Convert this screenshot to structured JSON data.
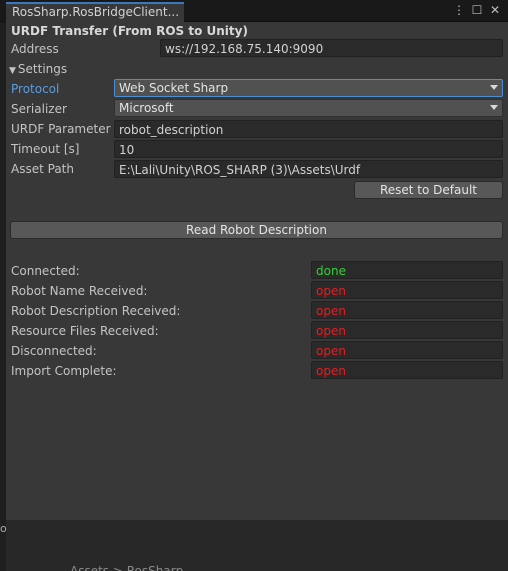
{
  "tab": {
    "title": "RosSharp.RosBridgeClient..."
  },
  "window_icons": {
    "menu": "⋮",
    "maximize": "☐",
    "close": "✕"
  },
  "header": {
    "title": "URDF Transfer (From ROS to Unity)"
  },
  "address": {
    "label": "Address",
    "value": "ws://192.168.75.140:9090"
  },
  "settings": {
    "label": "Settings",
    "toggle_icon": "▼"
  },
  "protocol": {
    "label": "Protocol",
    "value": "Web Socket Sharp"
  },
  "serializer": {
    "label": "Serializer",
    "value": "Microsoft"
  },
  "urdf_parameter": {
    "label": "URDF Parameter",
    "value": "robot_description"
  },
  "timeout": {
    "label": "Timeout [s]",
    "value": "10"
  },
  "asset_path": {
    "label": "Asset Path",
    "value": "E:\\Lali\\Unity\\ROS_SHARP (3)\\Assets\\Urdf"
  },
  "buttons": {
    "reset": "Reset to Default",
    "read": "Read Robot Description"
  },
  "status": [
    {
      "label": "Connected:",
      "value": "done",
      "color": "#35d135"
    },
    {
      "label": "Robot Name Received:",
      "value": "open",
      "color": "#e02020"
    },
    {
      "label": "Robot Description Received:",
      "value": "open",
      "color": "#e02020"
    },
    {
      "label": "Resource Files Received:",
      "value": "open",
      "color": "#e02020"
    },
    {
      "label": "Disconnected:",
      "value": "open",
      "color": "#e02020"
    },
    {
      "label": "Import Complete:",
      "value": "open",
      "color": "#e02020"
    }
  ],
  "colors": {
    "label_active": "#5b9de1",
    "done": "#35d135",
    "open": "#e02020"
  },
  "background": {
    "edge_text": "o",
    "breadcrumb": "Assets > RosSharp"
  }
}
